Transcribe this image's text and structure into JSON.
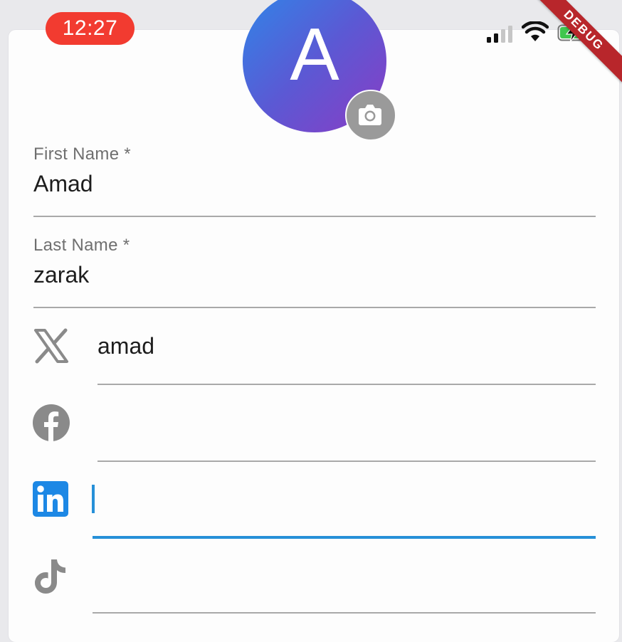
{
  "status_bar": {
    "time": "12:27"
  },
  "debug_banner": "DEBUG",
  "avatar": {
    "initial": "A"
  },
  "form": {
    "first_name": {
      "label": "First Name *",
      "value": "Amad"
    },
    "last_name": {
      "label": "Last Name *",
      "value": "zarak"
    },
    "social": [
      {
        "platform": "x-icon",
        "value": "amad"
      },
      {
        "platform": "facebook-icon",
        "value": ""
      },
      {
        "platform": "linkedin-icon",
        "value": ""
      },
      {
        "platform": "tiktok-icon",
        "value": ""
      }
    ]
  },
  "colors": {
    "time_pill": "#f23b30",
    "avatar_gradient": [
      "#2f86e8",
      "#8a3cc4"
    ],
    "focus_accent": "#2690d8",
    "linkedin": "#1d88e5",
    "debug_ribbon": "#b8262b"
  }
}
